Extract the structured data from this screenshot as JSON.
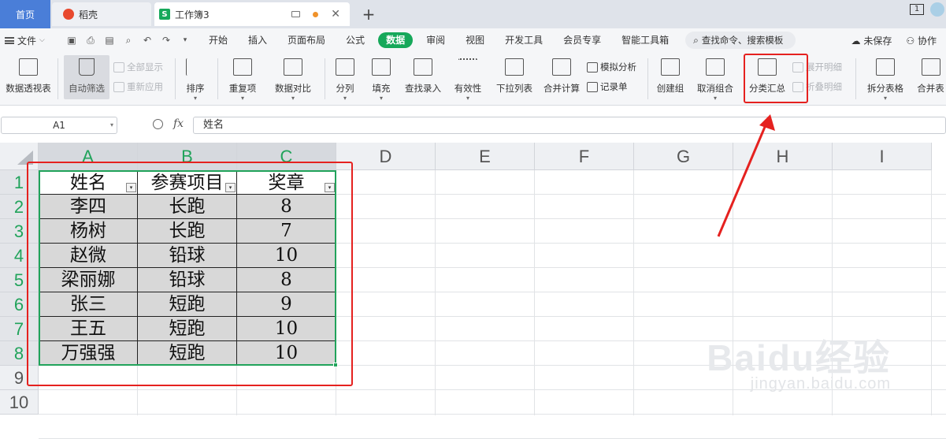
{
  "tabs": {
    "home": "首页",
    "wps": "稻壳",
    "book": "工作簿3",
    "plus": "+",
    "window_num": "1"
  },
  "menu": {
    "file": "文件",
    "items": [
      "开始",
      "插入",
      "页面布局",
      "公式",
      "数据",
      "审阅",
      "视图",
      "开发工具",
      "会员专享",
      "智能工具箱"
    ],
    "active": "数据",
    "search": "查找命令、搜索模板",
    "unsaved": "未保存",
    "collab": "协作"
  },
  "ribbon": {
    "pivot": "数据透视表",
    "autofilter": "自动筛选",
    "show_all": "全部显示",
    "reapply": "重新应用",
    "sort": "排序",
    "duplicates": "重复项",
    "compare": "数据对比",
    "split_col": "分列",
    "fill": "填充",
    "lookup_entry": "查找录入",
    "validity": "有效性",
    "dropdown_list": "下拉列表",
    "consolidate": "合并计算",
    "simulate": "模拟分析",
    "record": "记录单",
    "create_group": "创建组",
    "ungroup": "取消组合",
    "subtotal": "分类汇总",
    "expand_detail": "展开明细",
    "collapse_detail": "折叠明细",
    "split_table": "拆分表格",
    "merge_table": "合并表"
  },
  "formula_bar": {
    "name_box": "A1",
    "fx": "fx",
    "value": "姓名"
  },
  "columns": [
    "A",
    "B",
    "C",
    "D",
    "E",
    "F",
    "G",
    "H",
    "I"
  ],
  "rows": [
    "1",
    "2",
    "3",
    "4",
    "5",
    "6",
    "7",
    "8",
    "9",
    "10"
  ],
  "table": {
    "headers": [
      "姓名",
      "参赛项目",
      "奖章"
    ],
    "rows": [
      [
        "李四",
        "长跑",
        "8"
      ],
      [
        "杨树",
        "长跑",
        "7"
      ],
      [
        "赵微",
        "铅球",
        "10"
      ],
      [
        "梁丽娜",
        "铅球",
        "8"
      ],
      [
        "张三",
        "短跑",
        "9"
      ],
      [
        "王五",
        "短跑",
        "10"
      ],
      [
        "万强强",
        "短跑",
        "10"
      ]
    ]
  },
  "watermark": {
    "main": "Baidu经验",
    "sub": "jingyan.baidu.com"
  },
  "colors": {
    "accent_green": "#16a85a",
    "annotation_red": "#e5211f",
    "home_tab_blue": "#4a7ed8"
  }
}
